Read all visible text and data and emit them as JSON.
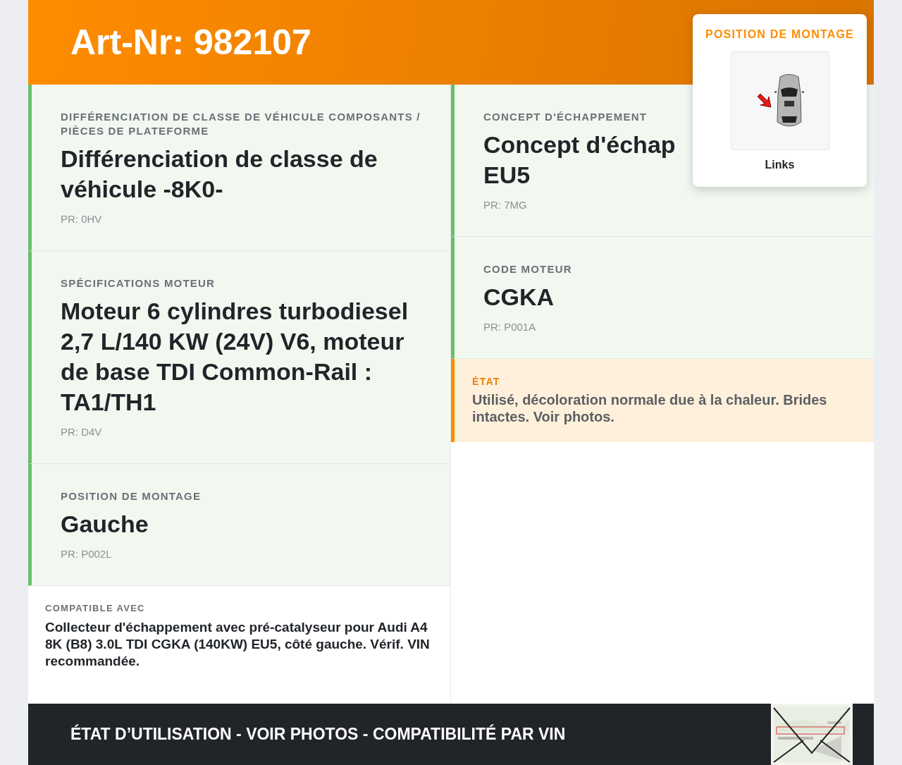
{
  "header": {
    "title": "Art-Nr: 982107"
  },
  "mount_card": {
    "label": "POSITION DE MONTAGE",
    "caption": "Links"
  },
  "left_specs": [
    {
      "label": "DIFFÉRENCIATION DE CLASSE DE VÉHICULE COMPOSANTS / PIÈCES DE PLATEFORME",
      "title_lines": [
        "Différenciation de classe de véhicule -8K0-"
      ],
      "pr": "PR: 0HV"
    },
    {
      "label": "SPÉCIFICATIONS MOTEUR",
      "title_lines": [
        "Moteur 6 cylindres turbodiesel 2,7 L/140 KW (24V) V6, moteur de base TDI Common-Rail : TA1/TH1"
      ],
      "pr": "PR: D4V"
    },
    {
      "label": "POSITION DE MONTAGE",
      "title_lines": [
        "Gauche"
      ],
      "pr": "PR: P002L"
    }
  ],
  "compatibility": {
    "label": "COMPATIBLE AVEC",
    "text": "Collecteur d'échappement avec pré-catalyseur pour Audi A4 8K (B8) 3.0L TDI CGKA (140KW) EU5, côté gauche. Vérif. VIN recommandée."
  },
  "right_specs": [
    {
      "label": "CONCEPT D'ÉCHAPPEMENT",
      "title_lines": [
        "Concept d'échap",
        "EU5"
      ],
      "pr": "PR: 7MG"
    },
    {
      "label": "CODE MOTEUR",
      "title_lines": [
        "CGKA"
      ],
      "pr": "PR: P001A"
    }
  ],
  "condition": {
    "label": "ÉTAT",
    "text": "Utilisé, décoloration normale due à la chaleur. Brides intactes. Voir photos."
  },
  "footer": {
    "text": "ÉTAT D’UTILISATION - VOIR PHOTOS - COMPATIBILITÉ PAR VIN"
  }
}
